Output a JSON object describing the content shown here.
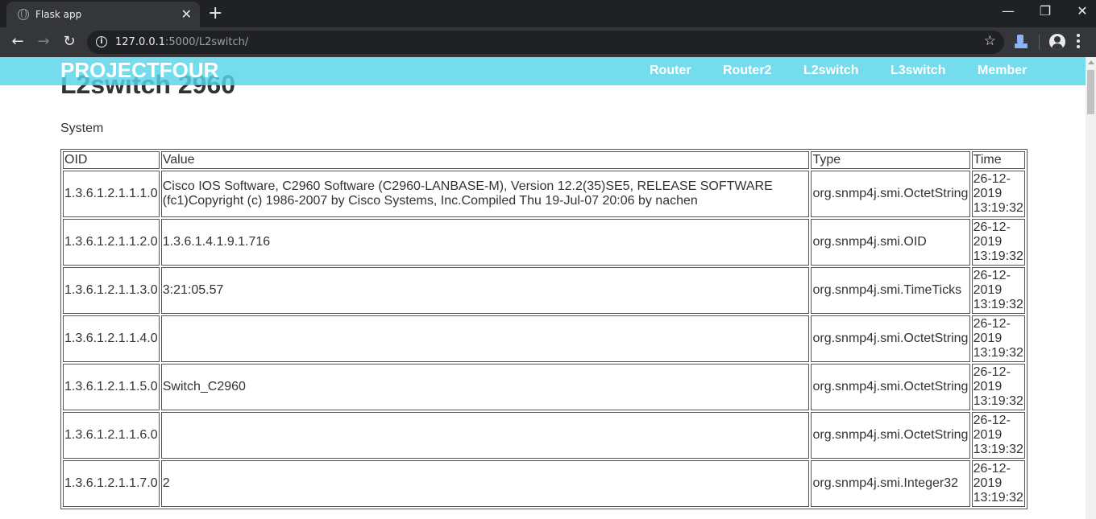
{
  "browser": {
    "tab_title": "Flask app",
    "tab_close": "✕",
    "new_tab": "+",
    "window_controls": {
      "minimize": "—",
      "maximize": "❐",
      "close": "✕"
    },
    "nav": {
      "back": "←",
      "forward": "→",
      "reload": "↻"
    },
    "url_host": "127.0.0.1",
    "url_path": ":5000/L2switch/",
    "info_icon": "i",
    "bookmark_icon": "☆"
  },
  "navbar": {
    "brand": "PROJECTFOUR",
    "links": [
      "Router",
      "Router2",
      "L2switch",
      "L3switch",
      "Member"
    ]
  },
  "page": {
    "title": "L2switch 2960",
    "section": "System"
  },
  "table": {
    "headers": [
      "OID",
      "Value",
      "Type",
      "Time"
    ],
    "rows": [
      {
        "oid": "1.3.6.1.2.1.1.1.0",
        "value": "Cisco IOS Software, C2960 Software (C2960-LANBASE-M), Version 12.2(35)SE5, RELEASE SOFTWARE (fc1)Copyright (c) 1986-2007 by Cisco Systems, Inc.Compiled Thu 19-Jul-07 20:06 by nachen",
        "type": "org.snmp4j.smi.OctetString",
        "time": "26-12-2019 13:19:32"
      },
      {
        "oid": "1.3.6.1.2.1.1.2.0",
        "value": "1.3.6.1.4.1.9.1.716",
        "type": "org.snmp4j.smi.OID",
        "time": "26-12-2019 13:19:32"
      },
      {
        "oid": "1.3.6.1.2.1.1.3.0",
        "value": "3:21:05.57",
        "type": "org.snmp4j.smi.TimeTicks",
        "time": "26-12-2019 13:19:32"
      },
      {
        "oid": "1.3.6.1.2.1.1.4.0",
        "value": "",
        "type": "org.snmp4j.smi.OctetString",
        "time": "26-12-2019 13:19:32"
      },
      {
        "oid": "1.3.6.1.2.1.1.5.0",
        "value": "Switch_C2960",
        "type": "org.snmp4j.smi.OctetString",
        "time": "26-12-2019 13:19:32"
      },
      {
        "oid": "1.3.6.1.2.1.1.6.0",
        "value": "",
        "type": "org.snmp4j.smi.OctetString",
        "time": "26-12-2019 13:19:32"
      },
      {
        "oid": "1.3.6.1.2.1.1.7.0",
        "value": "2",
        "type": "org.snmp4j.smi.Integer32",
        "time": "26-12-2019 13:19:32"
      }
    ]
  }
}
